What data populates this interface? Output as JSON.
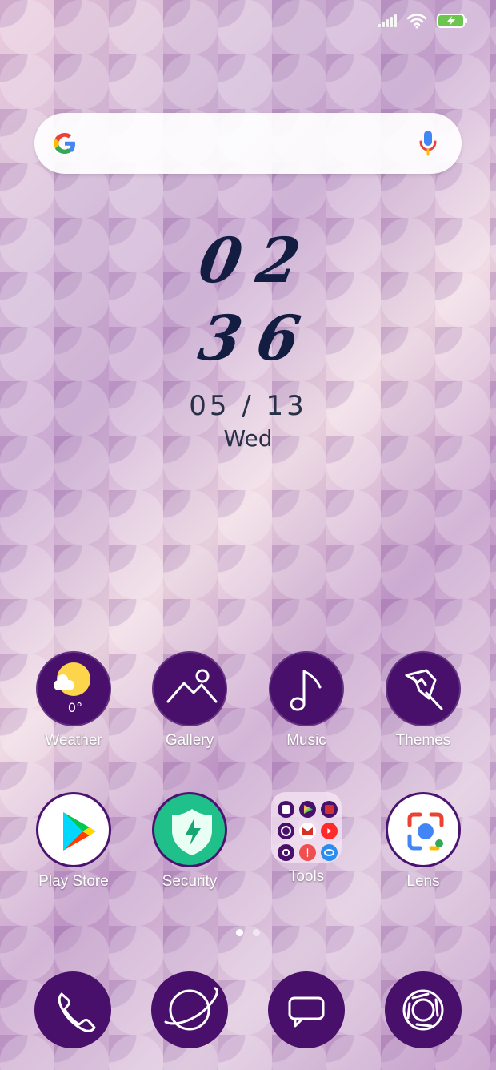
{
  "clock": {
    "digits_top": [
      "0",
      "2"
    ],
    "digits_bottom": [
      "3",
      "6"
    ],
    "date": "05 / 13",
    "day": "Wed"
  },
  "apps": {
    "weather": {
      "label": "Weather",
      "temp": "0°"
    },
    "gallery": {
      "label": "Gallery"
    },
    "music": {
      "label": "Music"
    },
    "themes": {
      "label": "Themes"
    },
    "play_store": {
      "label": "Play Store"
    },
    "security": {
      "label": "Security"
    },
    "tools": {
      "label": "Tools"
    },
    "lens": {
      "label": "Lens"
    }
  },
  "page_indicator": {
    "pages": 2,
    "active_page": 1
  },
  "icons": {
    "status": [
      "signal-icon",
      "wifi-icon",
      "battery-charging-icon"
    ],
    "search": [
      "google-icon",
      "mic-icon"
    ],
    "dock": [
      "phone-icon",
      "browser-icon",
      "messages-icon",
      "camera-icon"
    ]
  },
  "colors": {
    "icon_background": "#49106b",
    "clock_text": "#131d42"
  }
}
